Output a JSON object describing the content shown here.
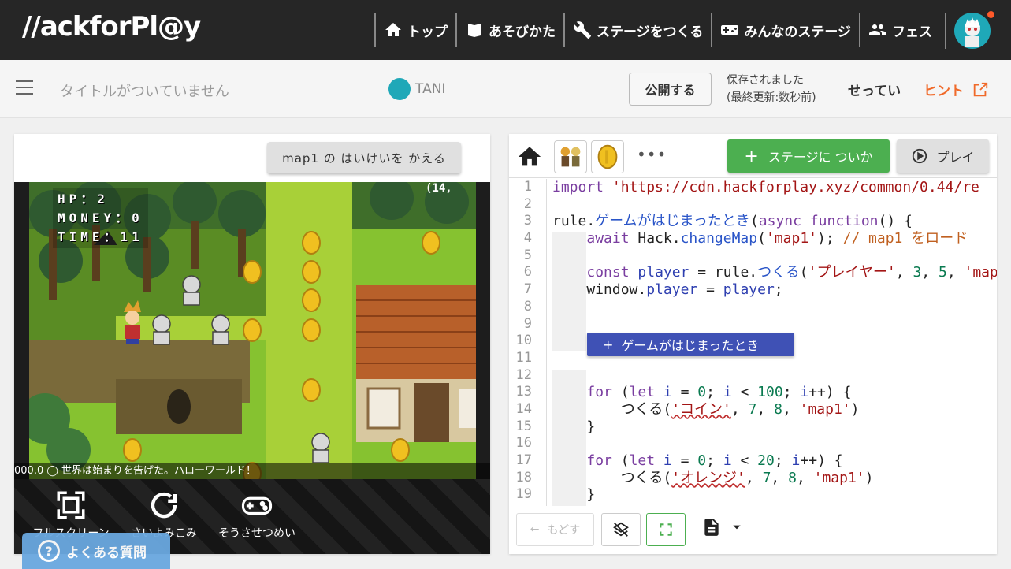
{
  "brand": {
    "logo_text": "//ackforPl@y"
  },
  "nav": {
    "items": [
      {
        "label": "トップ",
        "icon": "home-icon"
      },
      {
        "label": "あそびかた",
        "icon": "book-icon"
      },
      {
        "label": "ステージをつくる",
        "icon": "wrench-icon"
      },
      {
        "label": "みんなのステージ",
        "icon": "gamepad-icon"
      },
      {
        "label": "フェス",
        "icon": "people-icon"
      }
    ]
  },
  "subheader": {
    "title_placeholder": "タイトルがついていません",
    "owner_name": "TANI",
    "publish_label": "公開する",
    "save_status": "保存されました",
    "last_updated": "(最終更新:数秒前)",
    "settings_label": "せってい",
    "hint_label": "ヒント"
  },
  "game": {
    "change_bg_label": "map1 の はいけいを かえる",
    "hud": {
      "hp": "HP：2",
      "money": "MONEY：0",
      "time": "TIME：11"
    },
    "coord_text": "(14,",
    "log_text": "000.0  ◯  世界は始まりを告げた。ハローワールド！",
    "controls": [
      {
        "label": "フルスクリーン",
        "icon": "fullscreen-icon"
      },
      {
        "label": "さいよみこみ",
        "icon": "reload-icon"
      },
      {
        "label": "そうさせつめい",
        "icon": "gamepad-help-icon"
      }
    ],
    "faq_label": "よくある質問"
  },
  "editor": {
    "add_stage_label": "ステージに ついか",
    "play_label": "プレイ",
    "more_label": "•••",
    "insert_block_label": "ゲームがはじまったとき",
    "undo_label": "もどす",
    "line_numbers": [
      "1",
      "2",
      "3",
      "4",
      "5",
      "6",
      "7",
      "8",
      "9",
      "10",
      "11",
      "12",
      "13",
      "14",
      "15",
      "16",
      "17",
      "18",
      "19"
    ]
  },
  "colors": {
    "nav_bg": "#262626",
    "accent_green": "#4caf50",
    "accent_orange": "#f06a2a",
    "block_blue": "#3f51b5"
  }
}
